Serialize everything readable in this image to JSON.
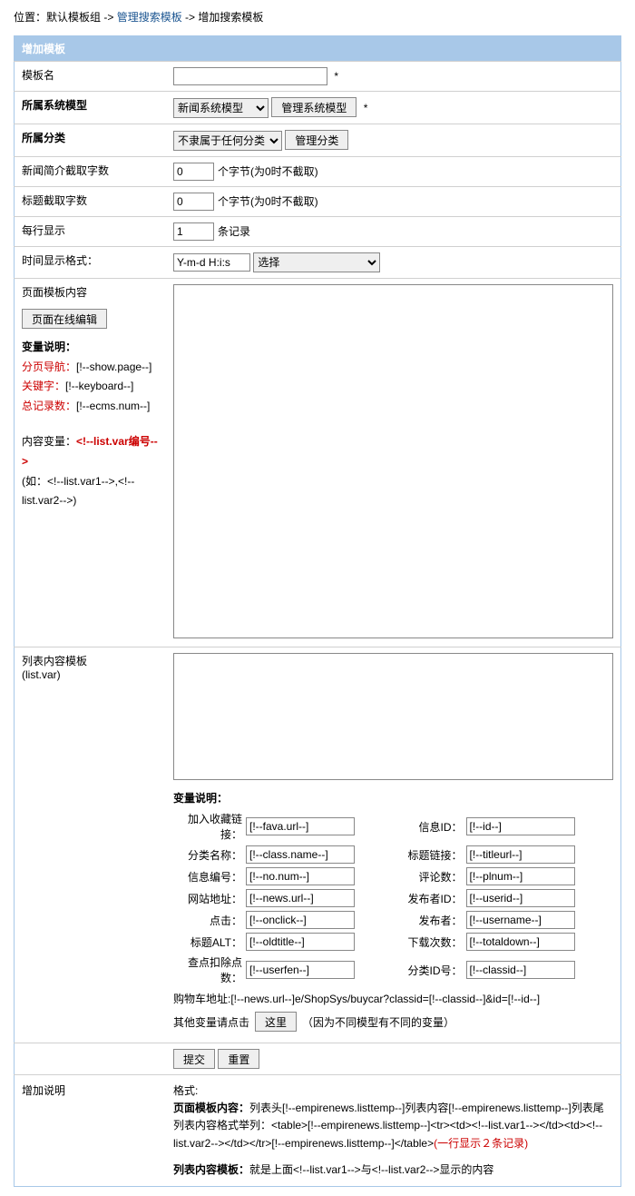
{
  "breadcrumb": {
    "prefix": "位置：",
    "item1": "默认模板组",
    "sep": " -> ",
    "item2": "管理搜索模板",
    "item3": "增加搜索模板"
  },
  "header": "增加模板",
  "rows": {
    "templateName": {
      "label": "模板名",
      "star": " *"
    },
    "systemModel": {
      "label": "所属系统模型",
      "option": "新闻系统模型",
      "btn": "管理系统模型",
      "star": " *"
    },
    "category": {
      "label": "所属分类",
      "option": "不隶属于任何分类",
      "btn": "管理分类"
    },
    "newsIntro": {
      "label": "新闻简介截取字数",
      "value": "0",
      "note": "个字节(为0时不截取)"
    },
    "titleCut": {
      "label": "标题截取字数",
      "value": "0",
      "note": "个字节(为0时不截取)"
    },
    "perRow": {
      "label": "每行显示",
      "value": "1",
      "note": "条记录"
    },
    "timeFormat": {
      "label": "时间显示格式：",
      "value": "Y-m-d H:i:s",
      "option": "选择"
    },
    "pageContent": {
      "label": "页面模板内容",
      "editBtn": "页面在线编辑",
      "varTitle": "变量说明：",
      "pageNav": {
        "l": "分页导航：",
        "v": "[!--show.page--]"
      },
      "keyword": {
        "l": "关键字：",
        "v": "[!--keyboard--]"
      },
      "total": {
        "l": "总记录数：",
        "v": "[!--ecms.num--]"
      },
      "contentVar": {
        "l": "内容变量：",
        "v": "<!--list.var编号-->"
      },
      "contentNote": "(如：<!--list.var1-->,<!--list.var2-->)"
    },
    "listContent": {
      "label": "列表内容模板",
      "sub": "(list.var)",
      "varTitle": "变量说明：",
      "vars": {
        "favUrl": {
          "l": "加入收藏链接：",
          "v": "[!--fava.url--]"
        },
        "infoId": {
          "l": "信息ID：",
          "v": "[!--id--]"
        },
        "className": {
          "l": "分类名称：",
          "v": "[!--class.name--]"
        },
        "titleLink": {
          "l": "标题链接：",
          "v": "[!--titleurl--]"
        },
        "infoNum": {
          "l": "信息编号：",
          "v": "[!--no.num--]"
        },
        "comments": {
          "l": "评论数：",
          "v": "[!--plnum--]"
        },
        "siteUrl": {
          "l": "网站地址：",
          "v": "[!--news.url--]"
        },
        "pubId": {
          "l": "发布者ID：",
          "v": "[!--userid--]"
        },
        "clicks": {
          "l": "点击：",
          "v": "[!--onclick--]"
        },
        "publisher": {
          "l": "发布者：",
          "v": "[!--username--]"
        },
        "titleAlt": {
          "l": "标题ALT：",
          "v": "[!--oldtitle--]"
        },
        "downloads": {
          "l": "下载次数：",
          "v": "[!--totaldown--]"
        },
        "deduct": {
          "l": "查点扣除点数：",
          "v": "[!--userfen--]"
        },
        "classId": {
          "l": "分类ID号：",
          "v": "[!--classid--]"
        }
      },
      "cart": "购物车地址:[!--news.url--]e/ShopSys/buycar?classid=[!--classid--]&id=[!--id--]",
      "otherPre": "其他变量请点击",
      "otherBtn": "这里",
      "otherPost": "（因为不同模型有不同的变量）"
    },
    "submit": {
      "submit": "提交",
      "reset": "重置"
    },
    "desc": {
      "label": "增加说明",
      "format": "格式:",
      "line1a": "页面模板内容：",
      "line1b": "列表头[!--empirenews.listtemp--]列表内容[!--empirenews.listtemp--]列表尾",
      "line2": "列表内容格式举列：<table>[!--empirenews.listtemp--]<tr><td><!--list.var1--></td><td><!--list.var2--></td></tr>[!--empirenews.listtemp--]</table>",
      "line2red": "(一行显示２条记录)",
      "line3a": "列表内容模板：",
      "line3b": "就是上面<!--list.var1-->与<!--list.var2-->显示的内容"
    }
  }
}
